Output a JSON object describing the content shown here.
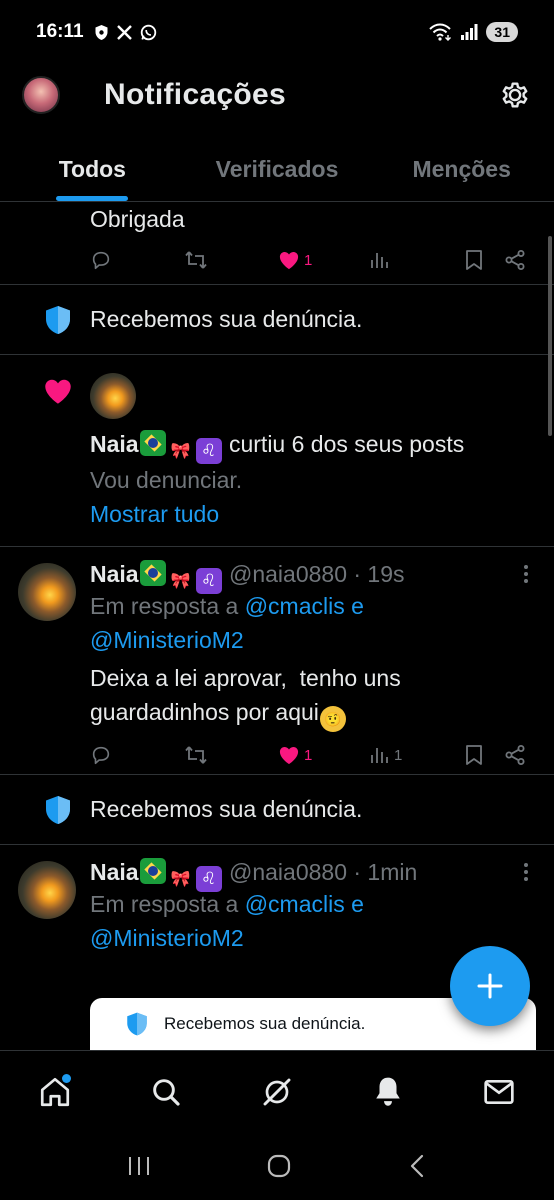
{
  "status_bar": {
    "time": "16:11",
    "battery": "31",
    "left_icons": [
      "shield-status-icon",
      "x-status-icon",
      "whatsapp-status-icon"
    ],
    "right_icons": [
      "wifi-icon",
      "signal-icon"
    ]
  },
  "header": {
    "title": "Notificações"
  },
  "tabs": [
    {
      "label": "Todos",
      "active": true
    },
    {
      "label": "Verificados",
      "active": false
    },
    {
      "label": "Menções",
      "active": false
    }
  ],
  "feed": {
    "partial_tweet": {
      "text": "Obrigada",
      "like_count": "1"
    },
    "report_1": {
      "text": "Recebemos sua denúncia."
    },
    "like_notification": {
      "name": "Naia",
      "action": " curtiu 6 dos seus posts",
      "preview": "Vou denunciar.",
      "show_all": "Mostrar tudo"
    },
    "reply_1": {
      "name": "Naia",
      "handle": "@naia0880",
      "time": "· 19s",
      "reply_prefix": "Em resposta a ",
      "reply_to_1": "@cmaclis",
      "reply_and": " e",
      "reply_to_2": "@MinisterioM2",
      "text_line1": "Deixa a lei aprovar,  tenho uns",
      "text_line2": "guardadinhos por aqui",
      "like_count": "1",
      "views_count": "1"
    },
    "report_2": {
      "text": "Recebemos sua denúncia."
    },
    "reply_2": {
      "name": "Naia",
      "handle": "@naia0880",
      "time": "· 1min",
      "reply_prefix": "Em resposta a ",
      "reply_to_1": "@cmaclis",
      "reply_and": " e",
      "reply_to_2": "@MinisterioM2"
    }
  },
  "toast": {
    "text": "Recebemos sua denúncia."
  },
  "fab": {
    "label": "+"
  },
  "bottom_nav": [
    "home-icon",
    "search-icon",
    "grok-icon",
    "bell-icon",
    "mail-icon"
  ],
  "colors": {
    "accent": "#1d9bf0",
    "like": "#f91880",
    "background": "#000000",
    "muted": "#71767b"
  }
}
